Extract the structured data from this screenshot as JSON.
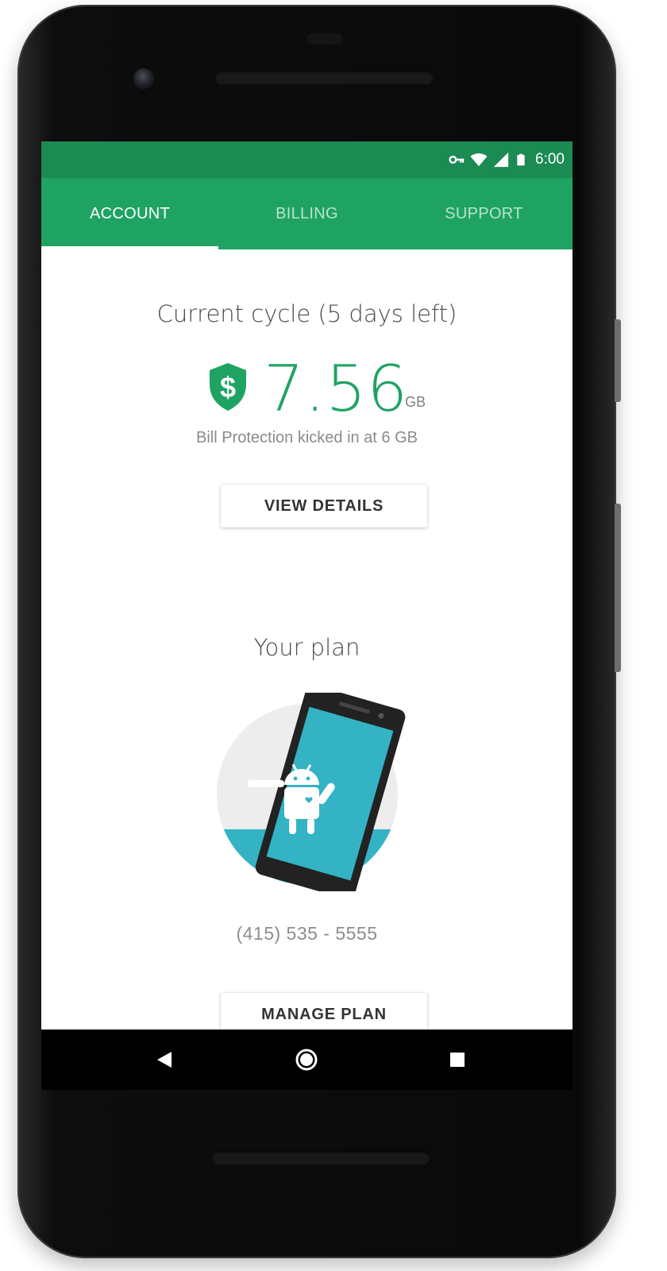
{
  "status_bar": {
    "time": "6:00",
    "icons": [
      "vpn-key-icon",
      "wifi-icon",
      "cellular-signal-icon",
      "battery-icon"
    ],
    "color": "#1b8a53"
  },
  "tabs": [
    {
      "label": "ACCOUNT",
      "selected": true
    },
    {
      "label": "BILLING",
      "selected": false
    },
    {
      "label": "SUPPORT",
      "selected": false
    }
  ],
  "tab_bar_color": "#1fa363",
  "current_cycle": {
    "title": "Current cycle (5 days left)",
    "usage_value": "7.56",
    "usage_unit": "GB",
    "icon": "shield-dollar-icon",
    "note": "Bill Protection kicked in at 6 GB",
    "accent_color": "#1fa363"
  },
  "view_details_label": "VIEW DETAILS",
  "plan": {
    "title": "Your plan",
    "illustration": "android-phone-illustration",
    "phone_number": "(415) 535 - 5555",
    "manage_label": "MANAGE PLAN"
  },
  "nav_bar": {
    "buttons": [
      "back-icon",
      "home-icon",
      "recents-icon"
    ]
  }
}
